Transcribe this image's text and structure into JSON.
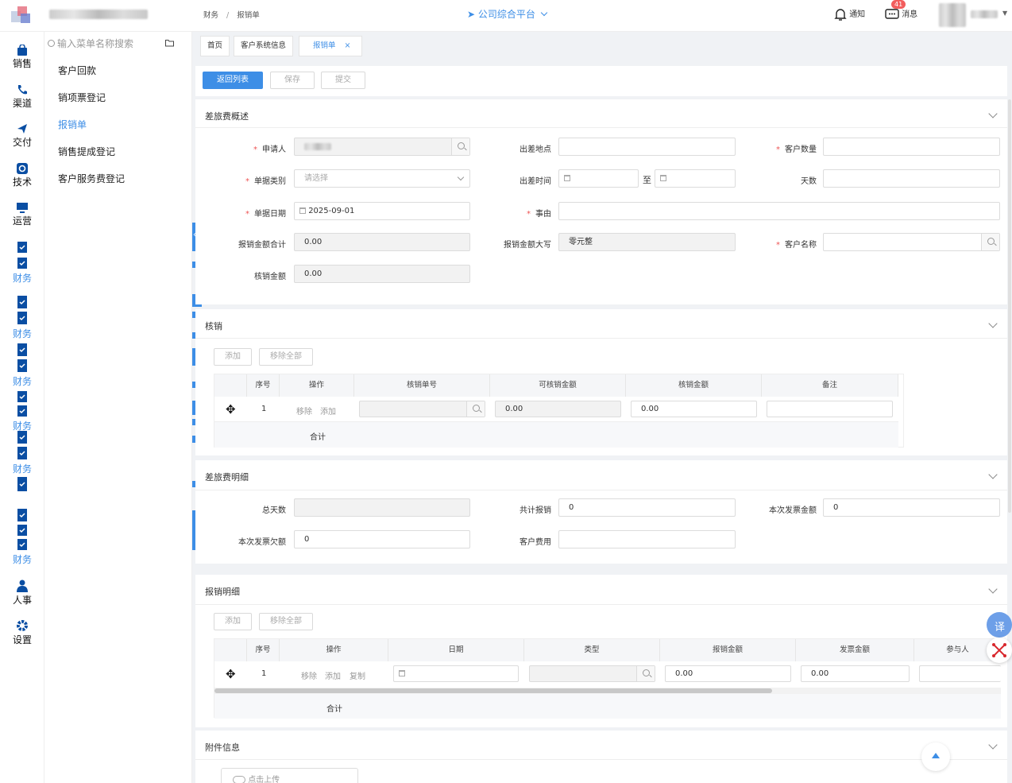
{
  "header": {
    "breadcrumb": [
      "财务",
      "/",
      "报销单"
    ],
    "platform_title": "公司综合平台",
    "notify_label": "通知",
    "message_label": "消息",
    "message_badge": "41"
  },
  "rail": {
    "items": [
      {
        "label": "销售",
        "icon": "shopping-bag-icon"
      },
      {
        "label": "渠道",
        "icon": "phone-icon"
      },
      {
        "label": "交付",
        "icon": "send-icon"
      },
      {
        "label": "技术",
        "icon": "tech-icon"
      },
      {
        "label": "运营",
        "icon": "monitor-icon"
      },
      {
        "label": "财务",
        "icon": "clipboard-check-icon"
      },
      {
        "label": "财务",
        "icon": "clipboard-check-icon"
      },
      {
        "label": "财务",
        "icon": "clipboard-check-icon"
      },
      {
        "label": "财务",
        "icon": "clipboard-check-icon"
      },
      {
        "label": "财务",
        "icon": "clipboard-check-icon"
      },
      {
        "label": "财务",
        "icon": "clipboard-check-icon"
      },
      {
        "label": "人事",
        "icon": "user-icon"
      },
      {
        "label": "设置",
        "icon": "gear-icon"
      }
    ]
  },
  "menu": {
    "search_placeholder": "输入菜单名称搜索",
    "items": [
      "客户回款",
      "销项票登记",
      "报销单",
      "销售提成登记",
      "客户服务费登记"
    ]
  },
  "tabs": [
    "首页",
    "客户系统信息",
    "报销单"
  ],
  "toolbar": {
    "back": "返回列表",
    "save": "保存",
    "submit": "提交"
  },
  "overview": {
    "title": "差旅费概述",
    "applicant_label": "申请人",
    "trip_place_label": "出差地点",
    "customer_count_label": "客户数量",
    "doc_type_label": "单据类别",
    "doc_type_placeholder": "请选择",
    "trip_time_label": "出差时间",
    "to_label": "至",
    "days_label": "天数",
    "doc_date_label": "单据日期",
    "doc_date_value": "2025-09-01",
    "reason_label": "事由",
    "total_amount_label": "报销金额合计",
    "total_amount_value": "0.00",
    "amount_upper_label": "报销金额大写",
    "amount_upper_value": "零元整",
    "customer_name_label": "客户名称",
    "writeoff_amount_label": "核销金额",
    "writeoff_amount_value": "0.00"
  },
  "writeoff": {
    "title": "核销",
    "add": "添加",
    "remove_all": "移除全部",
    "columns": [
      "序号",
      "操作",
      "核销单号",
      "可核销金额",
      "核销金额",
      "备注"
    ],
    "row": {
      "no": "1",
      "remove": "移除",
      "add": "添加",
      "available": "0.00",
      "amount": "0.00"
    },
    "total_label": "合计"
  },
  "detail": {
    "title": "差旅费明细",
    "total_days_label": "总天数",
    "total_claim_label": "共计报销",
    "total_claim_value": "0",
    "invoice_amount_label": "本次发票金额",
    "invoice_amount_value": "0",
    "invoice_owed_label": "本次发票欠额",
    "invoice_owed_value": "0",
    "customer_fee_label": "客户费用"
  },
  "claim": {
    "title": "报销明细",
    "add": "添加",
    "remove_all": "移除全部",
    "columns": [
      "序号",
      "操作",
      "日期",
      "类型",
      "报销金额",
      "发票金额",
      "参与人"
    ],
    "row": {
      "no": "1",
      "remove": "移除",
      "add": "添加",
      "copy": "复制",
      "claim_amount": "0.00",
      "invoice_amount": "0.00"
    },
    "total_label": "合计"
  },
  "attachment": {
    "title": "附件信息",
    "upload": "点击上传"
  },
  "floating": {
    "translate": "译"
  },
  "colors": {
    "accent": "#3d8ee6",
    "required": "#e55555",
    "page_bg": "#f0f2f5"
  }
}
